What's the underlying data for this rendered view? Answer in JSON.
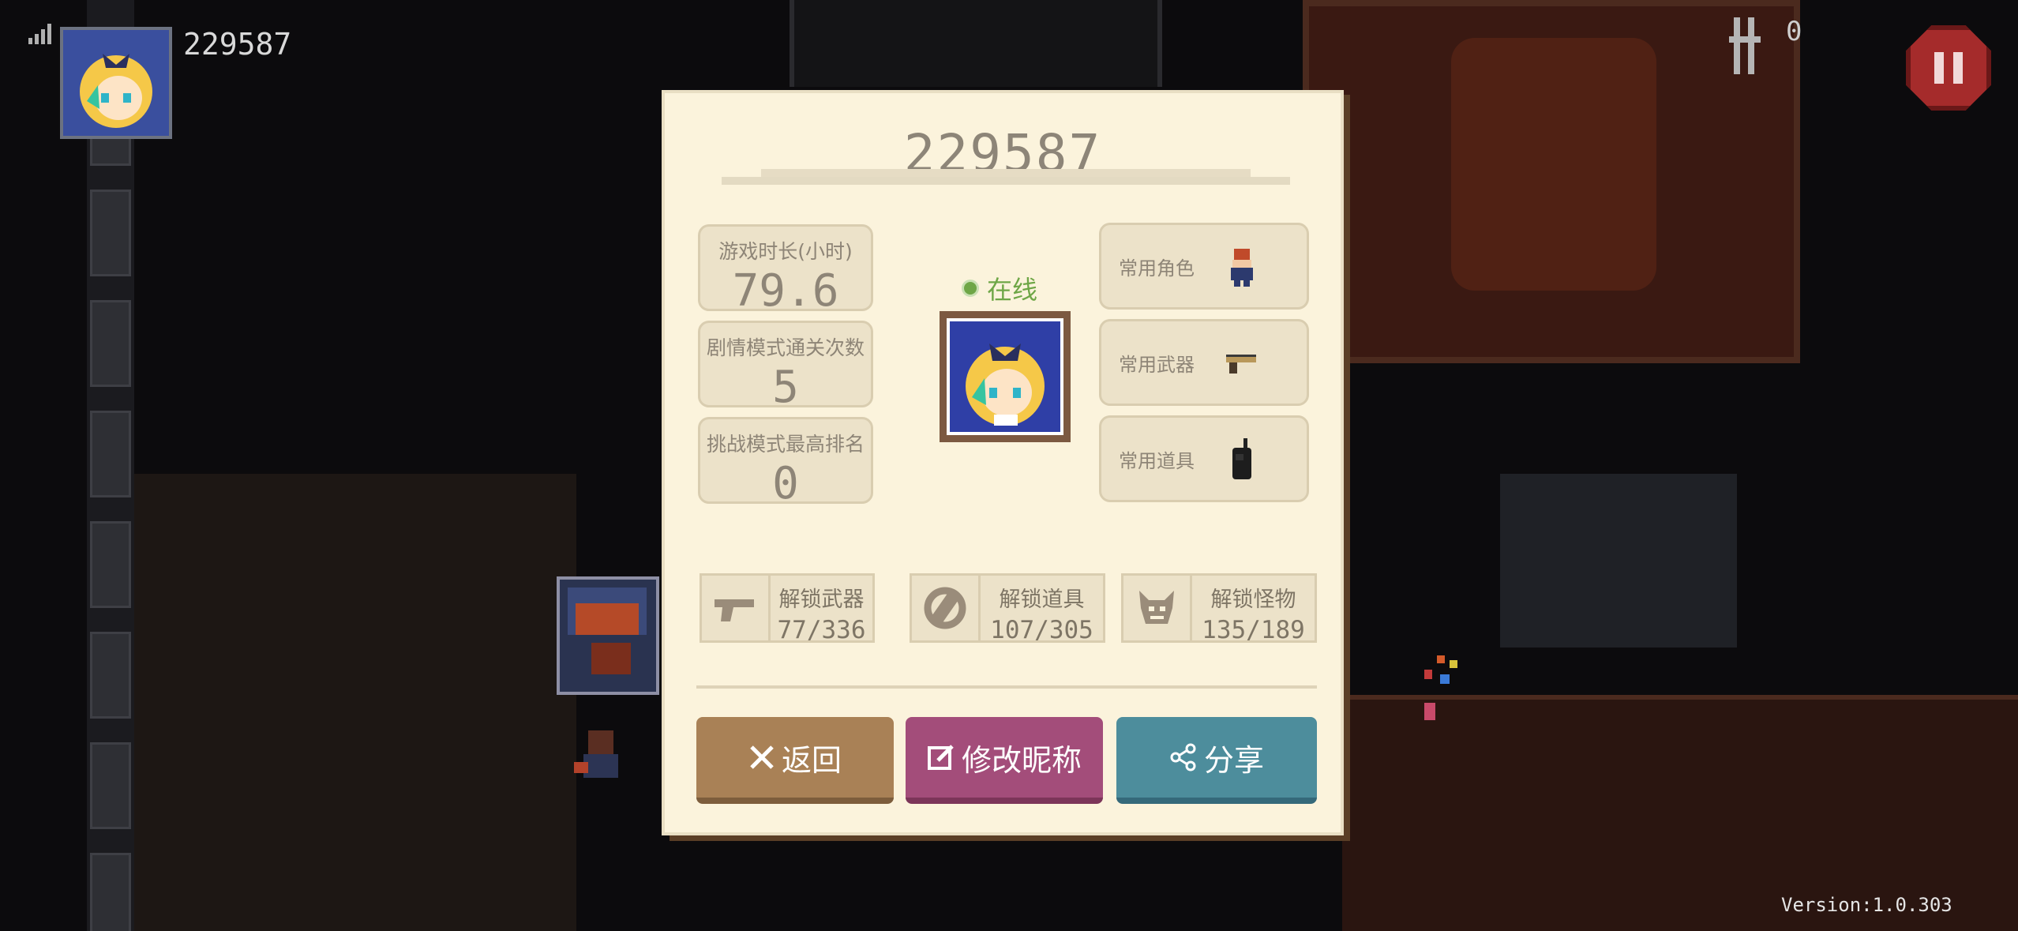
{
  "hud": {
    "player_name": "229587",
    "ammo_count": "0",
    "version": "Version:1.0.303"
  },
  "profile": {
    "title": "229587",
    "stats": [
      {
        "label": "游戏时长(小时)",
        "value": "79.6"
      },
      {
        "label": "剧情模式通关次数",
        "value": "5"
      },
      {
        "label": "挑战模式最高排名",
        "value": "0"
      }
    ],
    "status": "在线",
    "favorites": [
      {
        "label": "常用角色",
        "icon": "character-icon"
      },
      {
        "label": "常用武器",
        "icon": "pistol-icon"
      },
      {
        "label": "常用道具",
        "icon": "walkie-talkie-icon"
      }
    ],
    "unlocks": [
      {
        "label": "解锁武器",
        "value": "77/336",
        "icon": "gun-icon"
      },
      {
        "label": "解锁道具",
        "value": "107/305",
        "icon": "item-icon"
      },
      {
        "label": "解锁怪物",
        "value": "135/189",
        "icon": "monster-icon"
      }
    ],
    "buttons": {
      "back": "返回",
      "rename": "修改昵称",
      "share": "分享"
    }
  },
  "colors": {
    "panel": "#fbf3dc",
    "back_button": "#a98156",
    "rename_button": "#a34d7a",
    "share_button": "#4d8d9c",
    "online": "#6ea646",
    "pause_button": "#a52b2b"
  }
}
